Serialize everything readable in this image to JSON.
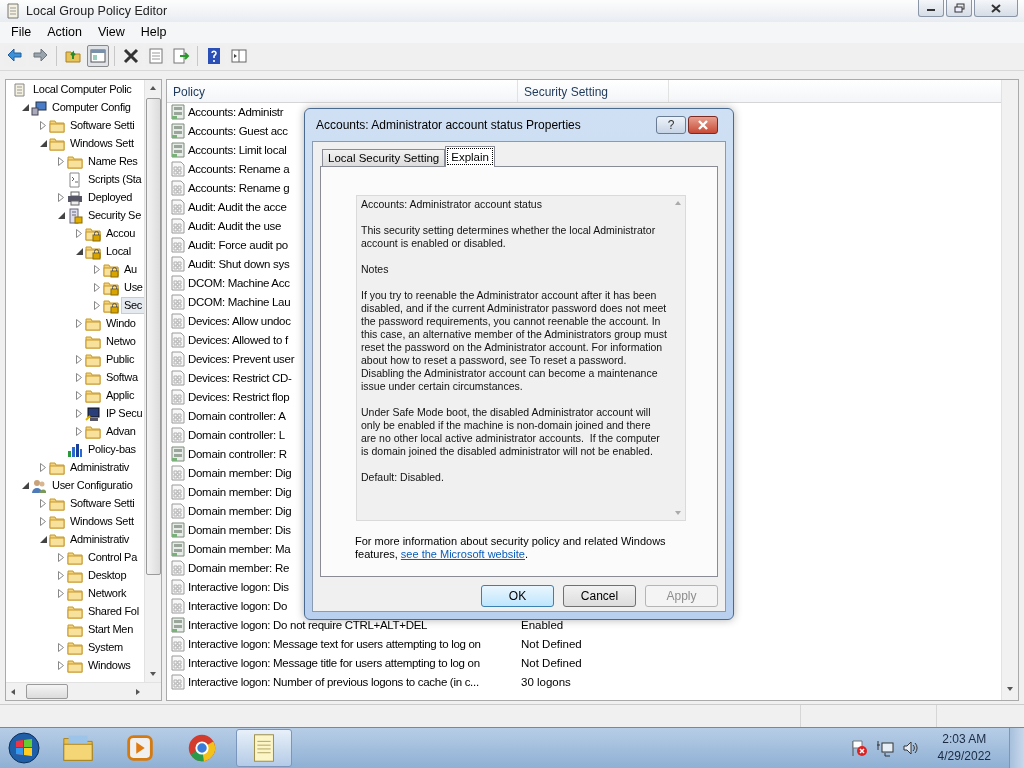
{
  "window": {
    "title": "Local Group Policy Editor"
  },
  "menu": [
    "File",
    "Action",
    "View",
    "Help"
  ],
  "toolbar": [
    {
      "kind": "back",
      "pressed": false
    },
    {
      "kind": "forward",
      "pressed": false
    },
    {
      "kind": "sep"
    },
    {
      "kind": "up",
      "pressed": false
    },
    {
      "kind": "tree",
      "pressed": true
    },
    {
      "kind": "sep"
    },
    {
      "kind": "delete",
      "pressed": false
    },
    {
      "kind": "properties",
      "pressed": false
    },
    {
      "kind": "export",
      "pressed": false
    },
    {
      "kind": "sep"
    },
    {
      "kind": "help",
      "pressed": false
    },
    {
      "kind": "view",
      "pressed": false
    }
  ],
  "tree": {
    "items": [
      {
        "label": "Local Computer Polic",
        "kind": "root",
        "selected": false,
        "children": [
          {
            "label": "Computer Config",
            "kind": "computer",
            "selected": false,
            "expanded": true,
            "children": [
              {
                "label": "Software Setti",
                "kind": "folder",
                "selected": false,
                "expanded": false
              },
              {
                "label": "Windows Sett",
                "kind": "folder",
                "selected": false,
                "expanded": true,
                "children": [
                  {
                    "label": "Name Res",
                    "kind": "folder",
                    "selected": false,
                    "expanded": false
                  },
                  {
                    "label": "Scripts (Sta",
                    "kind": "script",
                    "selected": false
                  },
                  {
                    "label": "Deployed",
                    "kind": "printer",
                    "selected": false,
                    "expanded": false
                  },
                  {
                    "label": "Security Se",
                    "kind": "security",
                    "selected": false,
                    "expanded": true,
                    "children": [
                      {
                        "label": "Accou",
                        "kind": "locked-folder",
                        "selected": false,
                        "expanded": false
                      },
                      {
                        "label": "Local",
                        "kind": "locked-folder",
                        "selected": false,
                        "expanded": true,
                        "children": [
                          {
                            "label": "Au",
                            "kind": "locked-folder",
                            "selected": false,
                            "expanded": false
                          },
                          {
                            "label": "Use",
                            "kind": "locked-folder",
                            "selected": false,
                            "expanded": false
                          },
                          {
                            "label": "Sec",
                            "kind": "locked-folder",
                            "selected": true,
                            "expanded": false
                          }
                        ]
                      },
                      {
                        "label": "Windo",
                        "kind": "folder",
                        "selected": false,
                        "expanded": false
                      },
                      {
                        "label": "Netwo",
                        "kind": "folder",
                        "selected": false
                      },
                      {
                        "label": "Public",
                        "kind": "folder",
                        "selected": false,
                        "expanded": false
                      },
                      {
                        "label": "Softwa",
                        "kind": "folder",
                        "selected": false,
                        "expanded": false
                      },
                      {
                        "label": "Applic",
                        "kind": "folder",
                        "selected": false,
                        "expanded": false
                      },
                      {
                        "label": "IP Secu",
                        "kind": "network-security",
                        "selected": false,
                        "expanded": false
                      },
                      {
                        "label": "Advan",
                        "kind": "folder",
                        "selected": false,
                        "expanded": false
                      }
                    ]
                  },
                  {
                    "label": "Policy-bas",
                    "kind": "chart",
                    "selected": false
                  }
                ]
              },
              {
                "label": "Administrativ",
                "kind": "folder",
                "selected": false,
                "expanded": false
              }
            ]
          },
          {
            "label": "User Configuratio",
            "kind": "users",
            "selected": false,
            "expanded": true,
            "children": [
              {
                "label": "Software Setti",
                "kind": "folder",
                "selected": false,
                "expanded": false
              },
              {
                "label": "Windows Sett",
                "kind": "folder",
                "selected": false,
                "expanded": false
              },
              {
                "label": "Administrativ",
                "kind": "folder",
                "selected": false,
                "expanded": true,
                "children": [
                  {
                    "label": "Control Pa",
                    "kind": "folder",
                    "selected": false,
                    "expanded": false
                  },
                  {
                    "label": "Desktop",
                    "kind": "folder",
                    "selected": false,
                    "expanded": false
                  },
                  {
                    "label": "Network",
                    "kind": "folder",
                    "selected": false,
                    "expanded": false
                  },
                  {
                    "label": "Shared Fol",
                    "kind": "folder",
                    "selected": false
                  },
                  {
                    "label": "Start Men",
                    "kind": "folder",
                    "selected": false
                  },
                  {
                    "label": "System",
                    "kind": "folder",
                    "selected": false,
                    "expanded": false
                  },
                  {
                    "label": "Windows",
                    "kind": "folder",
                    "selected": false,
                    "expanded": false
                  }
                ]
              }
            ]
          }
        ]
      }
    ]
  },
  "policy": {
    "columns": [
      "Policy",
      "Security Setting"
    ],
    "rows": [
      {
        "name": "Accounts: Administr",
        "kind": "server"
      },
      {
        "name": "Accounts: Guest acc",
        "kind": "server"
      },
      {
        "name": "Accounts: Limit local",
        "kind": "server"
      },
      {
        "name": "Accounts: Rename a",
        "kind": "doc"
      },
      {
        "name": "Accounts: Rename g",
        "kind": "doc"
      },
      {
        "name": "Audit: Audit the acce",
        "kind": "doc"
      },
      {
        "name": "Audit: Audit the use",
        "kind": "doc"
      },
      {
        "name": "Audit: Force audit po",
        "kind": "doc"
      },
      {
        "name": "Audit: Shut down sys",
        "kind": "doc"
      },
      {
        "name": "DCOM: Machine Acc",
        "kind": "doc"
      },
      {
        "name": "DCOM: Machine Lau",
        "kind": "doc"
      },
      {
        "name": "Devices: Allow undoc",
        "kind": "doc"
      },
      {
        "name": "Devices: Allowed to f",
        "kind": "doc"
      },
      {
        "name": "Devices: Prevent user",
        "kind": "doc"
      },
      {
        "name": "Devices: Restrict CD-",
        "kind": "doc"
      },
      {
        "name": "Devices: Restrict flop",
        "kind": "doc"
      },
      {
        "name": "Domain controller: A",
        "kind": "doc"
      },
      {
        "name": "Domain controller: L",
        "kind": "doc"
      },
      {
        "name": "Domain controller: R",
        "kind": "server"
      },
      {
        "name": "Domain member: Dig",
        "kind": "doc"
      },
      {
        "name": "Domain member: Dig",
        "kind": "doc"
      },
      {
        "name": "Domain member: Dig",
        "kind": "doc"
      },
      {
        "name": "Domain member: Dis",
        "kind": "server"
      },
      {
        "name": "Domain member: Ma",
        "kind": "server"
      },
      {
        "name": "Domain member: Re",
        "kind": "doc"
      },
      {
        "name": "Interactive logon: Dis",
        "kind": "doc"
      },
      {
        "name": "Interactive logon: Do",
        "kind": "doc"
      },
      {
        "name": "Interactive logon: Do not require CTRL+ALT+DEL",
        "kind": "server",
        "setting": "Enabled"
      },
      {
        "name": "Interactive logon: Message text for users attempting to log on",
        "kind": "doc",
        "setting": "Not Defined"
      },
      {
        "name": "Interactive logon: Message title for users attempting to log on",
        "kind": "doc",
        "setting": "Not Defined"
      },
      {
        "name": "Interactive logon: Number of previous logons to cache (in c...",
        "kind": "doc",
        "setting": "30 logons"
      }
    ]
  },
  "dialog": {
    "title": "Accounts: Administrator account status Properties",
    "help": "?",
    "tabs": [
      {
        "label": "Local Security Setting",
        "selected": false
      },
      {
        "label": "Explain",
        "selected": true
      }
    ],
    "explain": [
      "Accounts: Administrator account status",
      "This security setting determines whether the local Administrator account is enabled or disabled.",
      "Notes",
      "If you try to reenable the Administrator account after it has been disabled, and if the current Administrator password does not meet the password requirements, you cannot reenable the account. In this case, an alternative member of the Administrators group must reset the password on the Administrator account. For information about how to reset a password, see To reset a password. Disabling the Administrator account can become a maintenance issue under certain circumstances.",
      "Under Safe Mode boot, the disabled Administrator account will only be enabled if the machine is non-domain joined and there are no other local active administrator accounts.  If the computer is domain joined the disabled administrator will not be enabled.",
      "Default: Disabled."
    ],
    "footer": {
      "before": "For more information about security policy and related Windows features, ",
      "link": "see the Microsoft website",
      "after": "."
    },
    "buttons": [
      {
        "label": "OK",
        "default": true,
        "disabled": false
      },
      {
        "label": "Cancel",
        "default": false,
        "disabled": false
      },
      {
        "label": "Apply",
        "default": false,
        "disabled": true
      }
    ]
  },
  "taskbar": {
    "items": [
      {
        "kind": "explorer",
        "active": false
      },
      {
        "kind": "media",
        "active": false
      },
      {
        "kind": "browser",
        "active": false
      },
      {
        "kind": "notepad",
        "active": true
      }
    ],
    "time": "2:03 AM",
    "date": "4/29/2022"
  }
}
